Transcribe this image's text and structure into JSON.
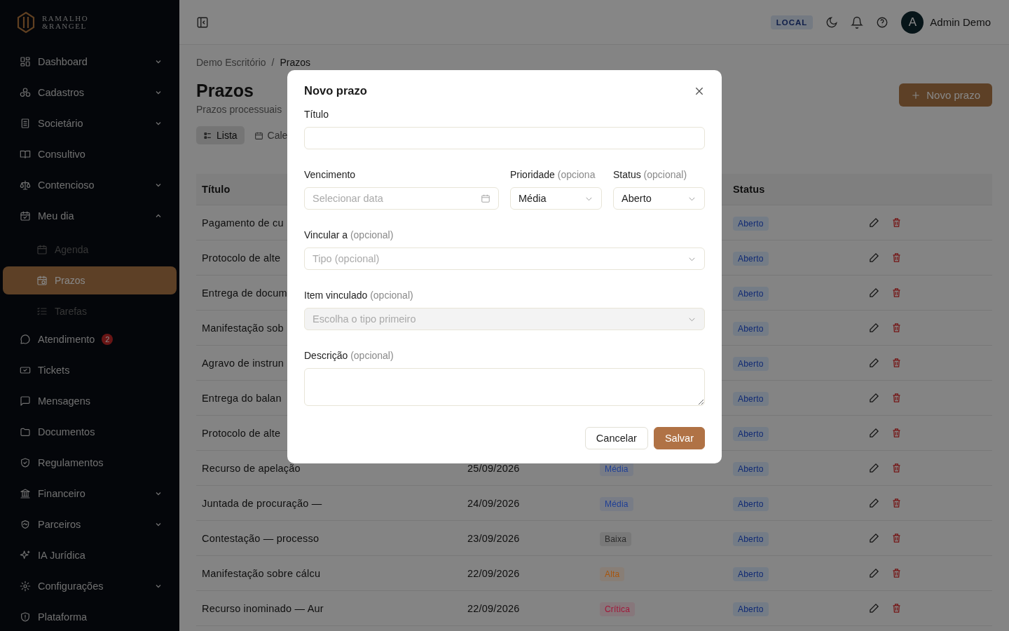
{
  "brand": {
    "line_1": "RAMALHO",
    "line_2": "&RANGEL"
  },
  "sidebar": {
    "items": [
      {
        "label": "Dashboard",
        "expandable": true,
        "expanded": false,
        "selected": false
      },
      {
        "label": "Cadastros",
        "expandable": true,
        "expanded": false,
        "selected": false
      },
      {
        "label": "Societário",
        "expandable": true,
        "expanded": false,
        "selected": false
      },
      {
        "label": "Consultivo",
        "expandable": false,
        "selected": false
      },
      {
        "label": "Contencioso",
        "expandable": true,
        "expanded": false,
        "selected": false
      },
      {
        "label": "Meu dia",
        "expandable": true,
        "expanded": true,
        "selected": false,
        "children": [
          {
            "label": "Agenda",
            "selected": false
          },
          {
            "label": "Prazos",
            "selected": true
          },
          {
            "label": "Tarefas",
            "selected": false
          }
        ]
      },
      {
        "label": "Atendimento",
        "expandable": false,
        "selected": false,
        "badge": "2"
      },
      {
        "label": "Tickets",
        "expandable": false,
        "selected": false
      },
      {
        "label": "Mensagens",
        "expandable": false,
        "selected": false
      },
      {
        "label": "Documentos",
        "expandable": false,
        "selected": false
      },
      {
        "label": "Regulamentos",
        "expandable": false,
        "selected": false
      },
      {
        "label": "Financeiro",
        "expandable": true,
        "expanded": false,
        "selected": false
      },
      {
        "label": "Parceiros",
        "expandable": true,
        "expanded": false,
        "selected": false
      },
      {
        "label": "IA Jurídica",
        "expandable": false,
        "selected": false
      },
      {
        "label": "Configurações",
        "expandable": true,
        "expanded": false,
        "selected": false
      },
      {
        "label": "Plataforma",
        "expandable": false,
        "selected": false
      }
    ]
  },
  "topbar": {
    "environment": "LOCAL",
    "avatar_letter": "A",
    "user_name": "Admin Demo"
  },
  "breadcrumb": [
    "Demo Escritório",
    "/",
    "Prazos"
  ],
  "page": {
    "title": "Prazos",
    "subtitle": "Prazos processuais",
    "new_button": "Novo prazo"
  },
  "view_tabs": [
    {
      "label": "Lista",
      "selected": true
    },
    {
      "label": "Cale",
      "selected": false
    }
  ],
  "table": {
    "columns": [
      "Título",
      "Status"
    ],
    "rows": [
      {
        "title": "Pagamento de cu",
        "status": "Aberto"
      },
      {
        "title": "Protocolo de alte",
        "status": "Aberto"
      },
      {
        "title": "Entrega de docum",
        "status": "Aberto"
      },
      {
        "title": "Manifestação sob",
        "status": "Aberto"
      },
      {
        "title": "Agravo de instrun",
        "status": "Aberto"
      },
      {
        "title": "Entrega do balan",
        "status": "Aberto"
      },
      {
        "title": "Protocolo de alte",
        "status": "Aberto"
      },
      {
        "title": "Recurso de apelação",
        "date": "25/09/2026",
        "priority": {
          "label": "Média",
          "color": "#1f3f96"
        },
        "status": "Aberto"
      },
      {
        "title": "Juntada de procuração —",
        "date": "24/09/2026",
        "priority": {
          "label": "Média",
          "color": "#1f3f96"
        },
        "status": "Aberto"
      },
      {
        "title": "Contestação — processo",
        "date": "23/09/2026",
        "priority": {
          "label": "Baixa",
          "color": "#2b2b2b"
        },
        "status": "Aberto"
      },
      {
        "title": "Manifestação sobre cálcu",
        "date": "22/09/2026",
        "priority": {
          "label": "Alta",
          "color": "#a8560e"
        },
        "status": "Aberto"
      },
      {
        "title": "Recurso inominado — Aur",
        "date": "22/09/2026",
        "priority": {
          "label": "Crítica",
          "color": "#a0183a"
        },
        "status": "Aberto"
      }
    ]
  },
  "modal": {
    "title": "Novo prazo",
    "rows": [
      [
        {
          "kind": "text",
          "label": "Título"
        }
      ],
      [
        {
          "kind": "date",
          "label": "Vencimento",
          "placeholder": "Selecionar data"
        },
        {
          "kind": "select",
          "label": "Prioridade",
          "hint": "(opciona",
          "value": "Média"
        },
        {
          "kind": "select",
          "label": "Status",
          "hint": "(opcional)",
          "value": "Aberto"
        }
      ],
      [
        {
          "kind": "select",
          "label": "Vincular a",
          "hint": "(opcional)",
          "placeholder": "Tipo (opcional)"
        }
      ],
      [
        {
          "kind": "select",
          "label": "Item vinculado",
          "hint": "(opcional)",
          "placeholder": "Escolha o tipo primeiro",
          "disabled": true
        }
      ],
      [
        {
          "kind": "textarea",
          "label": "Descrição",
          "hint": "(opcional)"
        }
      ]
    ],
    "cancel": "Cancelar",
    "save": "Salvar"
  }
}
